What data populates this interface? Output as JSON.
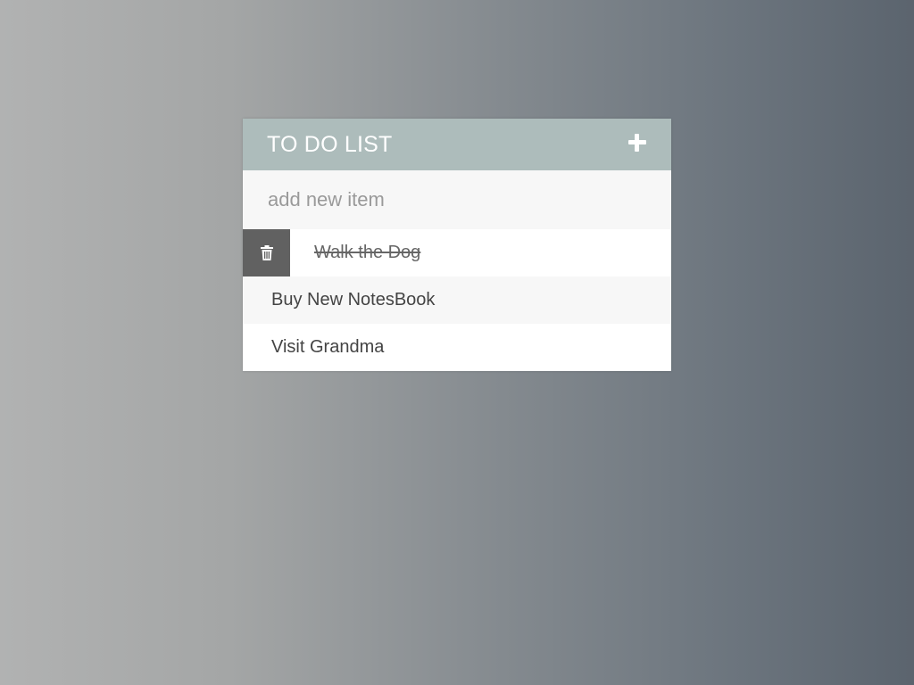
{
  "header": {
    "title": "TO DO LIST",
    "add_icon": "plus-icon"
  },
  "new_item": {
    "placeholder": "add new item",
    "value": ""
  },
  "todos": [
    {
      "text": "Walk the Dog",
      "completed": true,
      "hovered": true,
      "delete_icon": "trash-icon"
    },
    {
      "text": "Buy New NotesBook",
      "completed": false,
      "hovered": false
    },
    {
      "text": "Visit Grandma",
      "completed": false,
      "hovered": false
    }
  ],
  "colors": {
    "header_bg": "#adbcbb",
    "delete_bg": "#616161",
    "text": "#444444",
    "alt_row_bg": "#f7f7f7"
  }
}
